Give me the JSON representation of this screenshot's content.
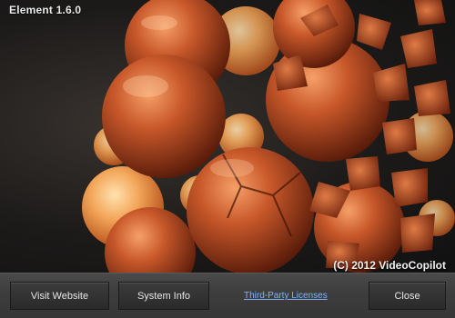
{
  "window": {
    "title": "Element 1.6.0"
  },
  "splash": {
    "copyright": "(C) 2012 VideoCopilot"
  },
  "footer": {
    "visit_website": "Visit Website",
    "system_info": "System Info",
    "licenses_link": "Third-Party Licenses",
    "close": "Close"
  },
  "colors": {
    "sphere_light": "#f4b46a",
    "sphere_dark": "#b5481f",
    "link": "#7fb2ff"
  }
}
